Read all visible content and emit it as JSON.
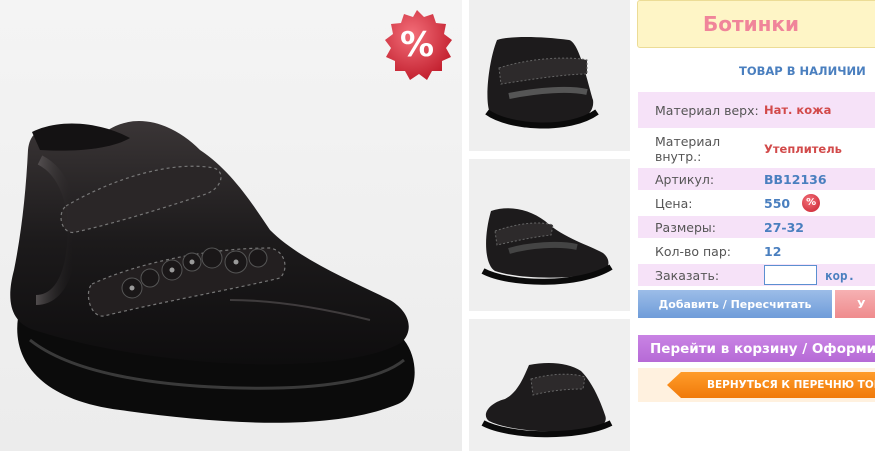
{
  "product": {
    "title": "Ботинки",
    "stock_status": "ТОВАР В НАЛИЧИИ",
    "sale_badge": "%",
    "price_sale_badge": "%"
  },
  "details": {
    "material_top_label": "Материал верх:",
    "material_top_value": "Нат. кожа",
    "material_inner_label": "Материал внутр.:",
    "material_inner_value": "Утеплитель",
    "article_label": "Артикул:",
    "article_value": "BB12136",
    "price_label": "Цена:",
    "price_value": "550",
    "sizes_label": "Размеры:",
    "sizes_value": "27-32",
    "pairs_label": "Кол-во пар:",
    "pairs_value": "12",
    "order_label": "Заказать:",
    "order_unit": "кор."
  },
  "order": {
    "quantity_value": "",
    "quantity_placeholder": ""
  },
  "buttons": {
    "add_label": "Добавить / Пересчитать",
    "delete_label": "У",
    "cart_label": "Перейти в корзину / Оформи",
    "back_label": "ВЕРНУТЬСЯ К ПЕРЕЧНЮ ТОВ"
  },
  "icons": {
    "main_image": "black-leather-boot-image",
    "thumbnails": [
      "boot-thumbnail-front",
      "boot-thumbnail-side",
      "boot-thumbnail-angle"
    ]
  },
  "colors": {
    "title": "#f0859a",
    "title_bg": "#fef5c6",
    "accent_blue": "#4a7fbf",
    "row_pink": "#f6e2f8",
    "add_button": "#7ea8df",
    "cart_button": "#bf74dd",
    "back_button": "#f7891a",
    "sale_red": "#d6293a"
  }
}
